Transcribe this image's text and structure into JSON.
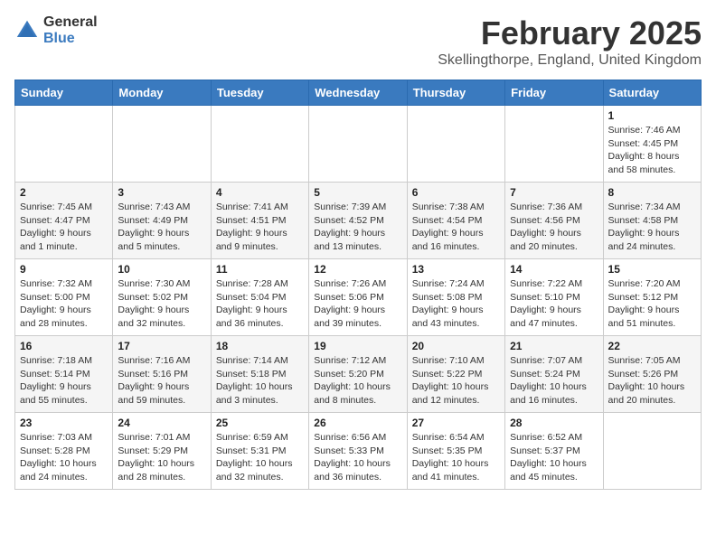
{
  "logo": {
    "general": "General",
    "blue": "Blue"
  },
  "title": {
    "month_year": "February 2025",
    "location": "Skellingthorpe, England, United Kingdom"
  },
  "days_of_week": [
    "Sunday",
    "Monday",
    "Tuesday",
    "Wednesday",
    "Thursday",
    "Friday",
    "Saturday"
  ],
  "weeks": [
    [
      {
        "day": "",
        "info": ""
      },
      {
        "day": "",
        "info": ""
      },
      {
        "day": "",
        "info": ""
      },
      {
        "day": "",
        "info": ""
      },
      {
        "day": "",
        "info": ""
      },
      {
        "day": "",
        "info": ""
      },
      {
        "day": "1",
        "info": "Sunrise: 7:46 AM\nSunset: 4:45 PM\nDaylight: 8 hours and 58 minutes."
      }
    ],
    [
      {
        "day": "2",
        "info": "Sunrise: 7:45 AM\nSunset: 4:47 PM\nDaylight: 9 hours and 1 minute."
      },
      {
        "day": "3",
        "info": "Sunrise: 7:43 AM\nSunset: 4:49 PM\nDaylight: 9 hours and 5 minutes."
      },
      {
        "day": "4",
        "info": "Sunrise: 7:41 AM\nSunset: 4:51 PM\nDaylight: 9 hours and 9 minutes."
      },
      {
        "day": "5",
        "info": "Sunrise: 7:39 AM\nSunset: 4:52 PM\nDaylight: 9 hours and 13 minutes."
      },
      {
        "day": "6",
        "info": "Sunrise: 7:38 AM\nSunset: 4:54 PM\nDaylight: 9 hours and 16 minutes."
      },
      {
        "day": "7",
        "info": "Sunrise: 7:36 AM\nSunset: 4:56 PM\nDaylight: 9 hours and 20 minutes."
      },
      {
        "day": "8",
        "info": "Sunrise: 7:34 AM\nSunset: 4:58 PM\nDaylight: 9 hours and 24 minutes."
      }
    ],
    [
      {
        "day": "9",
        "info": "Sunrise: 7:32 AM\nSunset: 5:00 PM\nDaylight: 9 hours and 28 minutes."
      },
      {
        "day": "10",
        "info": "Sunrise: 7:30 AM\nSunset: 5:02 PM\nDaylight: 9 hours and 32 minutes."
      },
      {
        "day": "11",
        "info": "Sunrise: 7:28 AM\nSunset: 5:04 PM\nDaylight: 9 hours and 36 minutes."
      },
      {
        "day": "12",
        "info": "Sunrise: 7:26 AM\nSunset: 5:06 PM\nDaylight: 9 hours and 39 minutes."
      },
      {
        "day": "13",
        "info": "Sunrise: 7:24 AM\nSunset: 5:08 PM\nDaylight: 9 hours and 43 minutes."
      },
      {
        "day": "14",
        "info": "Sunrise: 7:22 AM\nSunset: 5:10 PM\nDaylight: 9 hours and 47 minutes."
      },
      {
        "day": "15",
        "info": "Sunrise: 7:20 AM\nSunset: 5:12 PM\nDaylight: 9 hours and 51 minutes."
      }
    ],
    [
      {
        "day": "16",
        "info": "Sunrise: 7:18 AM\nSunset: 5:14 PM\nDaylight: 9 hours and 55 minutes."
      },
      {
        "day": "17",
        "info": "Sunrise: 7:16 AM\nSunset: 5:16 PM\nDaylight: 9 hours and 59 minutes."
      },
      {
        "day": "18",
        "info": "Sunrise: 7:14 AM\nSunset: 5:18 PM\nDaylight: 10 hours and 3 minutes."
      },
      {
        "day": "19",
        "info": "Sunrise: 7:12 AM\nSunset: 5:20 PM\nDaylight: 10 hours and 8 minutes."
      },
      {
        "day": "20",
        "info": "Sunrise: 7:10 AM\nSunset: 5:22 PM\nDaylight: 10 hours and 12 minutes."
      },
      {
        "day": "21",
        "info": "Sunrise: 7:07 AM\nSunset: 5:24 PM\nDaylight: 10 hours and 16 minutes."
      },
      {
        "day": "22",
        "info": "Sunrise: 7:05 AM\nSunset: 5:26 PM\nDaylight: 10 hours and 20 minutes."
      }
    ],
    [
      {
        "day": "23",
        "info": "Sunrise: 7:03 AM\nSunset: 5:28 PM\nDaylight: 10 hours and 24 minutes."
      },
      {
        "day": "24",
        "info": "Sunrise: 7:01 AM\nSunset: 5:29 PM\nDaylight: 10 hours and 28 minutes."
      },
      {
        "day": "25",
        "info": "Sunrise: 6:59 AM\nSunset: 5:31 PM\nDaylight: 10 hours and 32 minutes."
      },
      {
        "day": "26",
        "info": "Sunrise: 6:56 AM\nSunset: 5:33 PM\nDaylight: 10 hours and 36 minutes."
      },
      {
        "day": "27",
        "info": "Sunrise: 6:54 AM\nSunset: 5:35 PM\nDaylight: 10 hours and 41 minutes."
      },
      {
        "day": "28",
        "info": "Sunrise: 6:52 AM\nSunset: 5:37 PM\nDaylight: 10 hours and 45 minutes."
      },
      {
        "day": "",
        "info": ""
      }
    ]
  ]
}
